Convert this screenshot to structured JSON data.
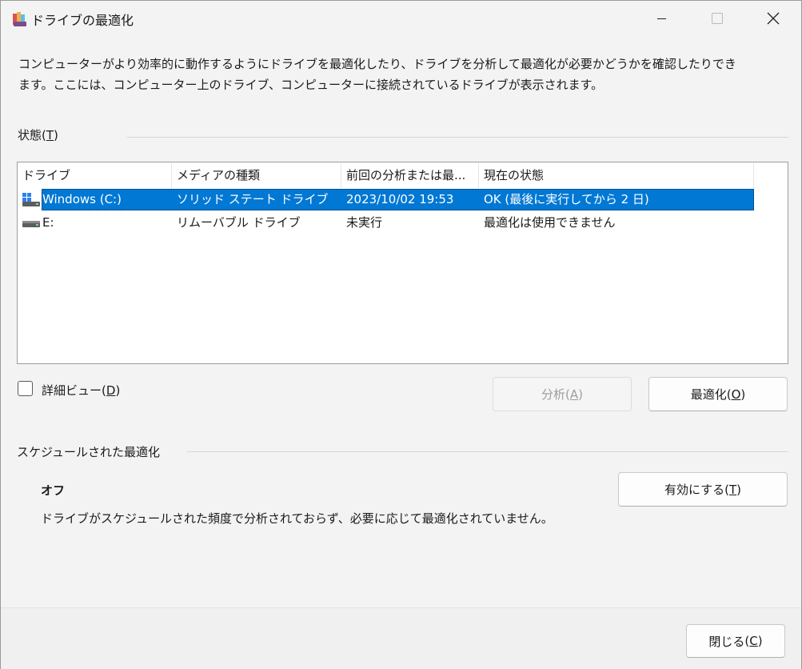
{
  "window": {
    "title": "ドライブの最適化",
    "description": "コンピューターがより効率的に動作するようにドライブを最適化したり、ドライブを分析して最適化が必要かどうかを確認したりできます。ここには、コンピューター上のドライブ、コンピューターに接続されているドライブが表示されます。"
  },
  "status": {
    "label": "状態",
    "accesskey": "T",
    "columns": [
      "ドライブ",
      "メディアの種類",
      "前回の分析または最...",
      "現在の状態"
    ],
    "rows": [
      {
        "drive": "Windows (C:)",
        "media": "ソリッド ステート ドライブ",
        "last": "2023/10/02 19:53",
        "state": "OK (最後に実行してから 2 日)",
        "icon": "windows-drive-icon",
        "selected": true
      },
      {
        "drive": "E:",
        "media": "リムーバブル ドライブ",
        "last": "未実行",
        "state": "最適化は使用できません",
        "icon": "removable-drive-icon",
        "selected": false
      }
    ]
  },
  "details": {
    "label": "詳細ビュー",
    "accesskey": "D",
    "checked": false
  },
  "buttons": {
    "analyze": {
      "label": "分析",
      "accesskey": "A",
      "enabled": false
    },
    "optimize": {
      "label": "最適化",
      "accesskey": "O"
    },
    "enable": {
      "label": "有効にする",
      "accesskey": "T"
    },
    "close": {
      "label": "閉じる",
      "accesskey": "C"
    }
  },
  "scheduled": {
    "label": "スケジュールされた最適化",
    "state": "オフ",
    "description": "ドライブがスケジュールされた頻度で分析されておらず、必要に応じて最適化されていません。"
  },
  "colors": {
    "selection": "#0078d4",
    "window_bg": "#f3f3f3"
  }
}
